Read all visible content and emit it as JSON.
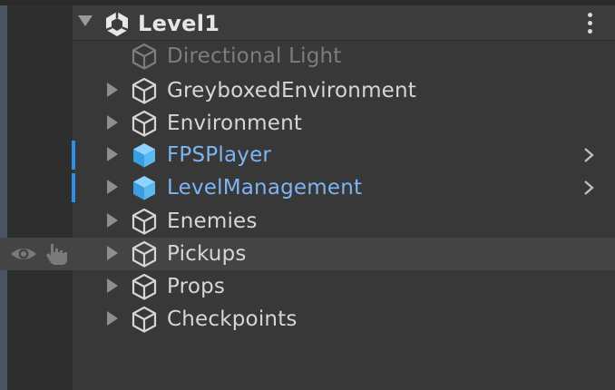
{
  "hierarchy": {
    "scene": {
      "title": "Level1",
      "icon": "unity-scene-icon",
      "menu_icon": "kebab-menu-icon"
    },
    "items": [
      {
        "label": "Directional Light",
        "icon": "gameobject-cube-icon",
        "has_children": false,
        "state": "disabled"
      },
      {
        "label": "GreyboxedEnvironment",
        "icon": "gameobject-cube-icon",
        "has_children": true,
        "state": "normal"
      },
      {
        "label": "Environment",
        "icon": "gameobject-cube-icon",
        "has_children": true,
        "state": "normal"
      },
      {
        "label": "FPSPlayer",
        "icon": "prefab-cube-icon",
        "has_children": true,
        "state": "prefab"
      },
      {
        "label": "LevelManagement",
        "icon": "prefab-cube-icon",
        "has_children": true,
        "state": "prefab"
      },
      {
        "label": "Enemies",
        "icon": "gameobject-cube-icon",
        "has_children": true,
        "state": "normal"
      },
      {
        "label": "Pickups",
        "icon": "gameobject-cube-icon",
        "has_children": true,
        "state": "hovered"
      },
      {
        "label": "Props",
        "icon": "gameobject-cube-icon",
        "has_children": true,
        "state": "normal"
      },
      {
        "label": "Checkpoints",
        "icon": "gameobject-cube-icon",
        "has_children": true,
        "state": "normal"
      }
    ]
  },
  "colors": {
    "background": "#383838",
    "gutter": "#2e2e2e",
    "text": "#d6d6d6",
    "disabled_text": "#7d7d7d",
    "prefab_text": "#7eb4f2",
    "prefab_icon": "#5cb8f0",
    "override_marker": "#2f8ee6"
  }
}
